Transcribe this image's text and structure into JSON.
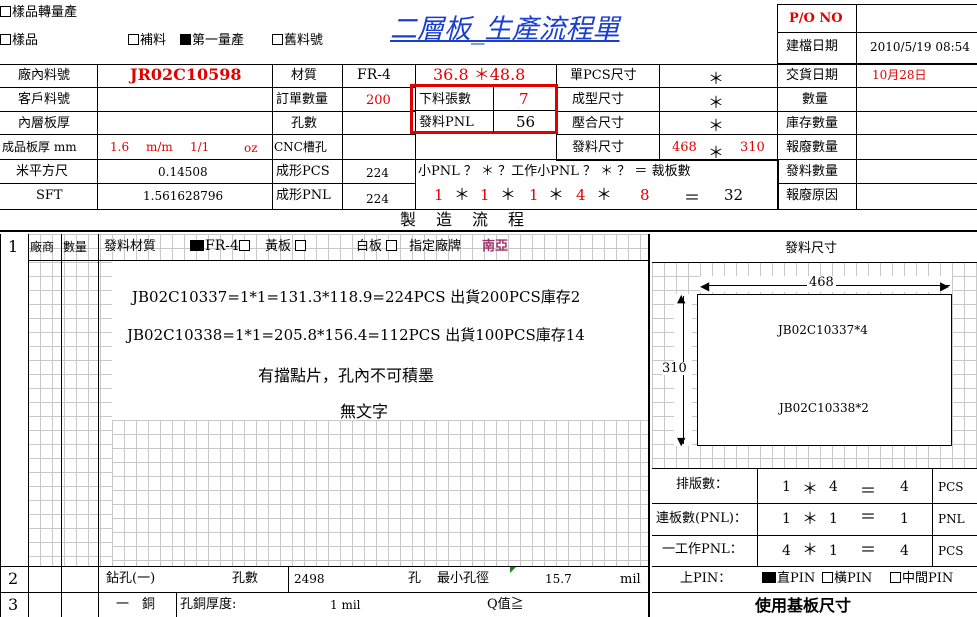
{
  "header": {
    "sample_to_production": "樣品轉量產",
    "sample": "樣品",
    "supplement": "補料",
    "first_production": "第一量產",
    "old_part_no": "舊料號",
    "title_part1": "二層板",
    "title_sep": "_",
    "title_part2": "生產流程單",
    "po_label": "P/O NO",
    "po_value": "",
    "created_label": "建檔日期",
    "created_value": "2010/5/19 08:54"
  },
  "info": {
    "factory_part_label": "廠內料號",
    "factory_part_value": "JR02C10598",
    "customer_part_label": "客戶料號",
    "customer_part_value": "",
    "inner_thickness_label": "內層板厚",
    "inner_thickness_value": "",
    "finished_thickness_label": "成品板厚 mm",
    "finished_thickness_value": "1.6",
    "mm_unit": "m/m",
    "copper_ratio": "1/1",
    "oz_unit": "oz",
    "sqm_label": "米平方尺",
    "sqm_value": "0.14508",
    "sft_label": "SFT",
    "sft_value": "1.561628796",
    "material_label": "材質",
    "material_value": "FR-4",
    "order_qty_label": "訂單數量",
    "order_qty_value": "200",
    "hole_count_label": "孔數",
    "hole_count_value": "",
    "cnc_slot_label": "CNC槽孔",
    "cnc_slot_value": "",
    "formed_pcs_label": "成形PCS",
    "formed_pcs_value": "224",
    "formed_pnl_label": "成形PNL",
    "formed_pnl_value": "224",
    "panel_size": "36.8 ＊48.8",
    "cut_sheets_label": "下料張數",
    "cut_sheets_value": "7",
    "issue_pnl_label": "發料PNL",
    "issue_pnl_value": "56",
    "unit_pcs_size_label": "單PCS尺寸",
    "unit_pcs_size_value": "＊",
    "formed_size_label": "成型尺寸",
    "formed_size_value": "＊",
    "pressed_size_label": "壓合尺寸",
    "pressed_size_value": "＊",
    "issue_size_label": "發料尺寸",
    "issue_size_w": "468",
    "issue_size_star": "＊",
    "issue_size_h": "310",
    "small_pnl_formula": "小PNL ？ ＊ ？工作小PNL ？ ＊ ？ ＝ 裁板數",
    "calc_a": "1",
    "calc_b": "1",
    "calc_c": "1",
    "calc_d": "4",
    "calc_e": "8",
    "calc_star": "＊",
    "calc_eq": "＝",
    "calc_result": "32",
    "delivery_label": "交貨日期",
    "delivery_value": "10月28日",
    "quantity_label": "數量",
    "stock_qty_label": "庫存數量",
    "scrap_qty_label": "報廢數量",
    "issue_qty_label": "發料數量",
    "scrap_reason_label": "報廢原因"
  },
  "process": {
    "section_title": "製　造　流　程",
    "row1_no": "1",
    "vendor_label": "廠商",
    "qty_label": "數量",
    "issue_material_label": "發料材質",
    "opt_fr4": "FR-4",
    "opt_yellow": "黃板",
    "opt_white": "白板",
    "opt_brand": "指定廠牌",
    "brand_value": "南亞",
    "note1": "JB02C10337=1*1=131.3*118.9=224PCS 出貨200PCS庫存2",
    "note2": "JB02C10338=1*1=205.8*156.4=112PCS 出貨100PCS庫存14",
    "note3": "有擋點片，孔內不可積墨",
    "note4": "無文字",
    "row2_no": "2",
    "drill_label": "鉆孔(一)",
    "hole_count_label": "孔數",
    "hole_count_value": "2498",
    "hole_unit": "孔",
    "min_hole_label": "最小孔徑",
    "min_hole_value": "15.7",
    "mil_unit": "mil",
    "row3_no": "3",
    "copper_label": "一　銅",
    "copper_thickness_label": "孔銅厚度:",
    "copper_thickness_value": "1 mil",
    "q_label": "Q值≧"
  },
  "diagram": {
    "title": "發料尺寸",
    "width_label": "468",
    "height_label": "310",
    "part_a": "JB02C10337*4",
    "part_b": "JB02C10338*2",
    "layout_count_label": "排版數：",
    "layout_a": "1",
    "layout_b": "4",
    "layout_result": "4",
    "pcs_unit": "PCS",
    "joined_label": "連板數(PNL)：",
    "joined_a": "1",
    "joined_b": "1",
    "joined_result": "1",
    "pnl_unit": "PNL",
    "work_pnl_label": "一工作PNL：",
    "work_a": "4",
    "work_b": "1",
    "work_result": "4",
    "pin_label": "上PIN：",
    "pin_straight": "直PIN",
    "pin_horizontal": "橫PIN",
    "pin_middle": "中間PIN",
    "star": "＊",
    "eq": "＝",
    "base_size_title": "使用基板尺寸"
  }
}
